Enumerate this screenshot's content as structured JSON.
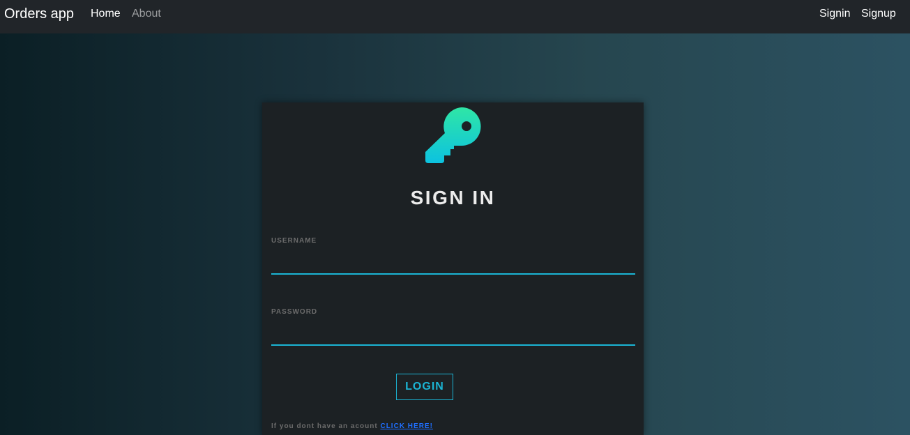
{
  "navbar": {
    "brand": "Orders app",
    "links": [
      {
        "label": "Home"
      },
      {
        "label": "About"
      }
    ],
    "right_links": [
      {
        "label": "Signin"
      },
      {
        "label": "Signup"
      }
    ]
  },
  "login_card": {
    "icon": "key-icon",
    "title": "SIGN IN",
    "username": {
      "label": "USERNAME",
      "value": "",
      "placeholder": ""
    },
    "password": {
      "label": "PASSWORD",
      "value": "",
      "placeholder": ""
    },
    "login_button": "LOGIN",
    "signup_prompt": "If you dont have an acount",
    "signup_link": "CLICK HERE!"
  },
  "colors": {
    "accent": "#1bb5d5",
    "link": "#1f6fff",
    "navbar_bg": "#212529",
    "card_bg": "#1c2124",
    "icon_gradient_top": "#2fe6a6",
    "icon_gradient_bottom": "#0cc2e0"
  }
}
